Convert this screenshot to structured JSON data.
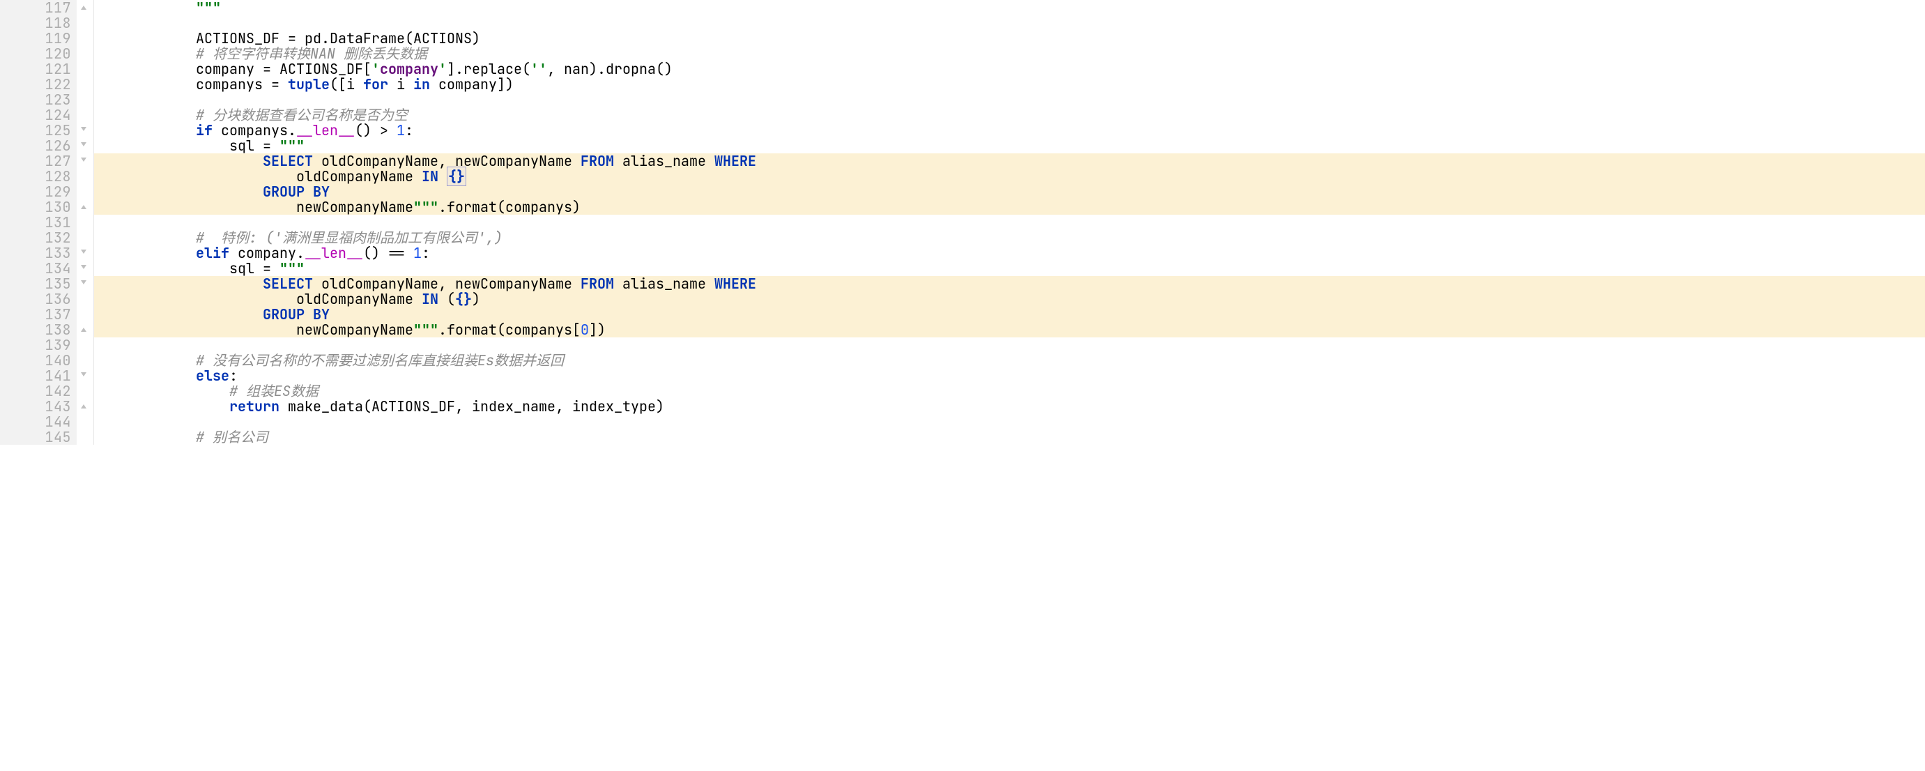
{
  "lineNumbers": [
    "117",
    "118",
    "119",
    "120",
    "121",
    "122",
    "123",
    "124",
    "125",
    "126",
    "127",
    "128",
    "129",
    "130",
    "131",
    "132",
    "133",
    "134",
    "135",
    "136",
    "137",
    "138",
    "139",
    "140",
    "141",
    "142",
    "143",
    "144",
    "145"
  ],
  "code": {
    "l117": {
      "indent": 12,
      "tokens": [
        {
          "t": "\"\"\"",
          "cls": "c-str-bold"
        }
      ]
    },
    "l118": {
      "indent": 0,
      "tokens": []
    },
    "l119": {
      "indent": 12,
      "tokens": [
        {
          "t": "ACTIONS_DF = pd.DataFrame(ACTIONS)",
          "cls": "c-ident"
        }
      ]
    },
    "l120": {
      "indent": 12,
      "tokens": [
        {
          "t": "# 将空字符串转换NAN 删除丢失数据",
          "cls": "c-comment"
        }
      ]
    },
    "l121": {
      "indent": 12,
      "tokens": [
        {
          "t": "company = ACTIONS_DF[",
          "cls": "c-ident"
        },
        {
          "t": "'",
          "cls": "c-str-bold"
        },
        {
          "t": "company",
          "cls": "c-field"
        },
        {
          "t": "'",
          "cls": "c-str-bold"
        },
        {
          "t": "].replace(",
          "cls": "c-ident"
        },
        {
          "t": "''",
          "cls": "c-str-bold"
        },
        {
          "t": ", nan).dropna()",
          "cls": "c-ident"
        }
      ]
    },
    "l122": {
      "indent": 12,
      "tokens": [
        {
          "t": "companys = ",
          "cls": "c-ident"
        },
        {
          "t": "tuple",
          "cls": "c-kw"
        },
        {
          "t": "([i ",
          "cls": "c-ident"
        },
        {
          "t": "for",
          "cls": "c-kw"
        },
        {
          "t": " i ",
          "cls": "c-ident"
        },
        {
          "t": "in",
          "cls": "c-kw"
        },
        {
          "t": " company])",
          "cls": "c-ident"
        }
      ]
    },
    "l123": {
      "indent": 0,
      "tokens": []
    },
    "l124": {
      "indent": 12,
      "tokens": [
        {
          "t": "# 分块数据查看公司名称是否为空",
          "cls": "c-comment"
        }
      ]
    },
    "l125": {
      "indent": 12,
      "tokens": [
        {
          "t": "if",
          "cls": "c-kw"
        },
        {
          "t": " companys.",
          "cls": "c-ident"
        },
        {
          "t": "__len__",
          "cls": "c-dunder"
        },
        {
          "t": "() > ",
          "cls": "c-ident"
        },
        {
          "t": "1",
          "cls": "c-num"
        },
        {
          "t": ":",
          "cls": "c-ident"
        }
      ]
    },
    "l126": {
      "indent": 16,
      "tokens": [
        {
          "t": "sql = ",
          "cls": "c-ident"
        },
        {
          "t": "\"\"\"",
          "cls": "c-str-bold"
        }
      ]
    },
    "l127": {
      "indent": 20,
      "hl": true,
      "tokens": [
        {
          "t": "SELECT",
          "cls": "c-sql-kw"
        },
        {
          "t": " oldCompanyName, newCompanyName ",
          "cls": "c-ident"
        },
        {
          "t": "FROM",
          "cls": "c-sql-kw"
        },
        {
          "t": " alias_name ",
          "cls": "c-ident"
        },
        {
          "t": "WHERE",
          "cls": "c-sql-kw"
        }
      ]
    },
    "l128": {
      "indent": 24,
      "hl": true,
      "tokens": [
        {
          "t": "oldCompanyName ",
          "cls": "c-ident"
        },
        {
          "t": "IN",
          "cls": "c-sql-kw"
        },
        {
          "t": " ",
          "cls": "c-ident"
        },
        {
          "t": "{}",
          "cls": "c-braces",
          "box": true
        }
      ]
    },
    "l129": {
      "indent": 20,
      "hl": true,
      "tokens": [
        {
          "t": "GROUP BY",
          "cls": "c-sql-kw"
        }
      ]
    },
    "l130": {
      "indent": 24,
      "hl": true,
      "tokens": [
        {
          "t": "newCompanyName",
          "cls": "c-ident"
        },
        {
          "t": "\"\"\"",
          "cls": "c-str-bold"
        },
        {
          "t": ".format(companys)",
          "cls": "c-ident"
        }
      ]
    },
    "l131": {
      "indent": 0,
      "tokens": []
    },
    "l132": {
      "indent": 12,
      "tokens": [
        {
          "t": "#  特例: ('满洲里显福肉制品加工有限公司',)",
          "cls": "c-comment"
        }
      ]
    },
    "l133": {
      "indent": 12,
      "tokens": [
        {
          "t": "elif",
          "cls": "c-kw"
        },
        {
          "t": " company.",
          "cls": "c-ident"
        },
        {
          "t": "__len__",
          "cls": "c-dunder"
        },
        {
          "t": "() == ",
          "cls": "c-ident"
        },
        {
          "t": "1",
          "cls": "c-num"
        },
        {
          "t": ":",
          "cls": "c-ident"
        }
      ]
    },
    "l134": {
      "indent": 16,
      "tokens": [
        {
          "t": "sql = ",
          "cls": "c-ident"
        },
        {
          "t": "\"\"\"",
          "cls": "c-str-bold"
        }
      ]
    },
    "l135": {
      "indent": 20,
      "hl": true,
      "tokens": [
        {
          "t": "SELECT",
          "cls": "c-sql-kw"
        },
        {
          "t": " oldCompanyName, newCompanyName ",
          "cls": "c-ident"
        },
        {
          "t": "FROM",
          "cls": "c-sql-kw"
        },
        {
          "t": " alias_name ",
          "cls": "c-ident"
        },
        {
          "t": "WHERE",
          "cls": "c-sql-kw"
        }
      ]
    },
    "l136": {
      "indent": 24,
      "hl": true,
      "tokens": [
        {
          "t": "oldCompanyName ",
          "cls": "c-ident"
        },
        {
          "t": "IN",
          "cls": "c-sql-kw"
        },
        {
          "t": " (",
          "cls": "c-ident"
        },
        {
          "t": "{}",
          "cls": "c-braces"
        },
        {
          "t": ")",
          "cls": "c-ident"
        }
      ]
    },
    "l137": {
      "indent": 20,
      "hl": true,
      "tokens": [
        {
          "t": "GROUP BY",
          "cls": "c-sql-kw"
        }
      ]
    },
    "l138": {
      "indent": 24,
      "hl": true,
      "tokens": [
        {
          "t": "newCompanyName",
          "cls": "c-ident"
        },
        {
          "t": "\"\"\"",
          "cls": "c-str-bold"
        },
        {
          "t": ".format(companys[",
          "cls": "c-ident"
        },
        {
          "t": "0",
          "cls": "c-num"
        },
        {
          "t": "])",
          "cls": "c-ident"
        }
      ]
    },
    "l139": {
      "indent": 0,
      "tokens": []
    },
    "l140": {
      "indent": 12,
      "tokens": [
        {
          "t": "# 没有公司名称的不需要过滤别名库直接组装Es数据并返回",
          "cls": "c-comment"
        }
      ]
    },
    "l141": {
      "indent": 12,
      "tokens": [
        {
          "t": "else",
          "cls": "c-kw"
        },
        {
          "t": ":",
          "cls": "c-ident"
        }
      ]
    },
    "l142": {
      "indent": 16,
      "tokens": [
        {
          "t": "# 组装ES数据",
          "cls": "c-comment"
        }
      ]
    },
    "l143": {
      "indent": 16,
      "tokens": [
        {
          "t": "return",
          "cls": "c-kw"
        },
        {
          "t": " make_data(ACTIONS_DF, index_name, index_type)",
          "cls": "c-ident"
        }
      ]
    },
    "l144": {
      "indent": 0,
      "tokens": []
    },
    "l145": {
      "indent": 12,
      "tokens": [
        {
          "t": "# 别名公司",
          "cls": "c-comment"
        }
      ]
    }
  },
  "foldMarkers": [
    {
      "line": 117,
      "type": "end"
    },
    {
      "line": 125,
      "type": "start"
    },
    {
      "line": 126,
      "type": "start"
    },
    {
      "line": 127,
      "type": "start"
    },
    {
      "line": 130,
      "type": "end"
    },
    {
      "line": 133,
      "type": "start"
    },
    {
      "line": 134,
      "type": "start"
    },
    {
      "line": 135,
      "type": "start"
    },
    {
      "line": 138,
      "type": "end"
    },
    {
      "line": 141,
      "type": "start"
    },
    {
      "line": 143,
      "type": "end"
    }
  ]
}
